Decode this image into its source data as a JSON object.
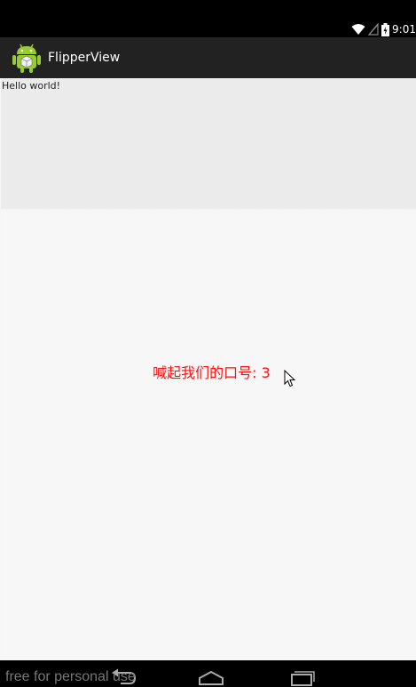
{
  "status_bar": {
    "time": "9:01",
    "icons": [
      "wifi-icon",
      "signal-icon",
      "battery-icon"
    ]
  },
  "action_bar": {
    "title": "FlipperView",
    "icon": "android-app-icon"
  },
  "content": {
    "hello_text": "Hello world!",
    "slogan": "喊起我们的口号: 3"
  },
  "watermark": "free for personal use",
  "nav_bar": {
    "buttons": [
      "back-icon",
      "home-icon",
      "recents-icon"
    ]
  },
  "colors": {
    "status_bar": "#000000",
    "action_bar": "#222222",
    "slogan": "#ff1010",
    "top_band": "#ebebeb",
    "background": "#f7f7f7"
  }
}
